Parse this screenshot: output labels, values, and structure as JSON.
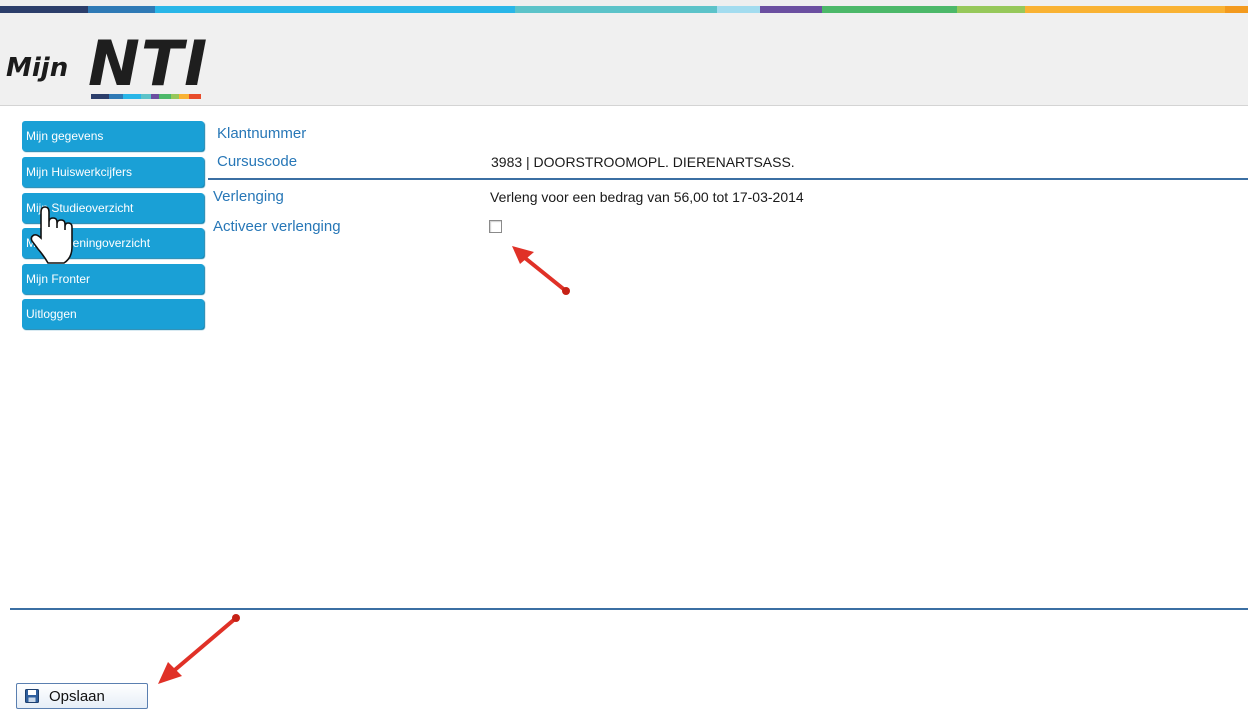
{
  "brand": {
    "logo_mijn": "Mijn",
    "logo_nti": "NTI",
    "stripe_colors": [
      "#2c3e6b",
      "#2f7ab6",
      "#29b6e8",
      "#5cc3c9",
      "#a3dcef",
      "#6b4fa0",
      "#4cb869",
      "#96c85a",
      "#f9b233",
      "#f39a1e"
    ]
  },
  "sidebar": {
    "items": [
      {
        "label": "Mijn gegevens"
      },
      {
        "label": "Mijn Huiswerkcijfers"
      },
      {
        "label": "Mijn Studieoverzicht"
      },
      {
        "label": "Mijn Rekeningoverzicht"
      },
      {
        "label": "Mijn Fronter"
      },
      {
        "label": "Uitloggen"
      }
    ]
  },
  "details": {
    "klantnummer_label": "Klantnummer",
    "cursuscode_label": "Cursuscode",
    "cursuscode_value": "3983 | DOORSTROOMOPL. DIERENARTSASS.",
    "verlenging_label": "Verlenging",
    "verlenging_value": "Verleng voor een bedrag van 56,00 tot 17-03-2014",
    "activeer_label": "Activeer verlenging",
    "activeer_checked": false
  },
  "actions": {
    "save_label": "Opslaan"
  },
  "colors": {
    "accent": "#1aa0d6",
    "label_blue": "#2777b7",
    "rule": "#3b6fa3",
    "arrow_red": "#e03127"
  },
  "icons": {
    "save": "floppy-disk-icon",
    "cursor": "hand-pointer-icon",
    "annotation": "red-arrow"
  }
}
